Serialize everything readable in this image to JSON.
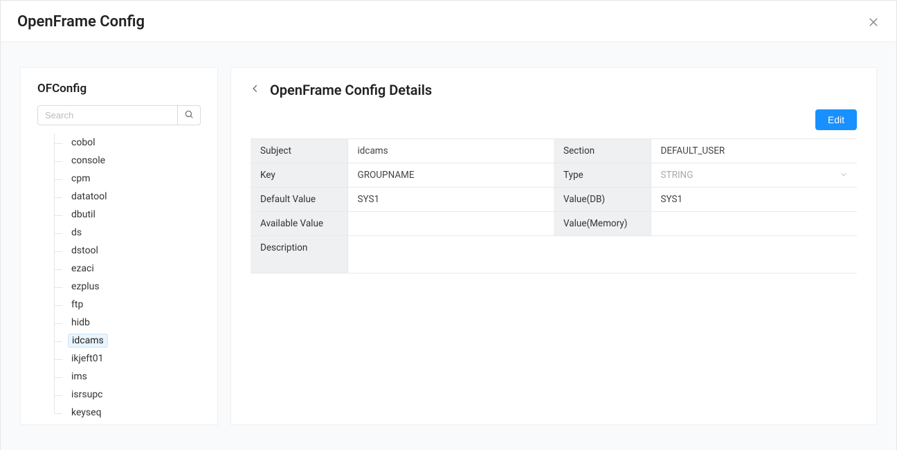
{
  "header": {
    "title": "OpenFrame Config"
  },
  "sidebar": {
    "title": "OFConfig",
    "search_placeholder": "Search",
    "items": [
      {
        "label": "cobol",
        "selected": false
      },
      {
        "label": "console",
        "selected": false
      },
      {
        "label": "cpm",
        "selected": false
      },
      {
        "label": "datatool",
        "selected": false
      },
      {
        "label": "dbutil",
        "selected": false
      },
      {
        "label": "ds",
        "selected": false
      },
      {
        "label": "dstool",
        "selected": false
      },
      {
        "label": "ezaci",
        "selected": false
      },
      {
        "label": "ezplus",
        "selected": false
      },
      {
        "label": "ftp",
        "selected": false
      },
      {
        "label": "hidb",
        "selected": false
      },
      {
        "label": "idcams",
        "selected": true
      },
      {
        "label": "ikjeft01",
        "selected": false
      },
      {
        "label": "ims",
        "selected": false
      },
      {
        "label": "isrsupc",
        "selected": false
      },
      {
        "label": "keyseq",
        "selected": false
      }
    ]
  },
  "main": {
    "title": "OpenFrame Config Details",
    "edit_label": "Edit",
    "fields": {
      "subject_label": "Subject",
      "subject_value": "idcams",
      "section_label": "Section",
      "section_value": "DEFAULT_USER",
      "key_label": "Key",
      "key_value": "GROUPNAME",
      "type_label": "Type",
      "type_value": "STRING",
      "default_value_label": "Default Value",
      "default_value_value": "SYS1",
      "value_db_label": "Value(DB)",
      "value_db_value": "SYS1",
      "available_value_label": "Available Value",
      "available_value_value": "",
      "value_memory_label": "Value(Memory)",
      "value_memory_value": "",
      "description_label": "Description",
      "description_value": ""
    }
  }
}
